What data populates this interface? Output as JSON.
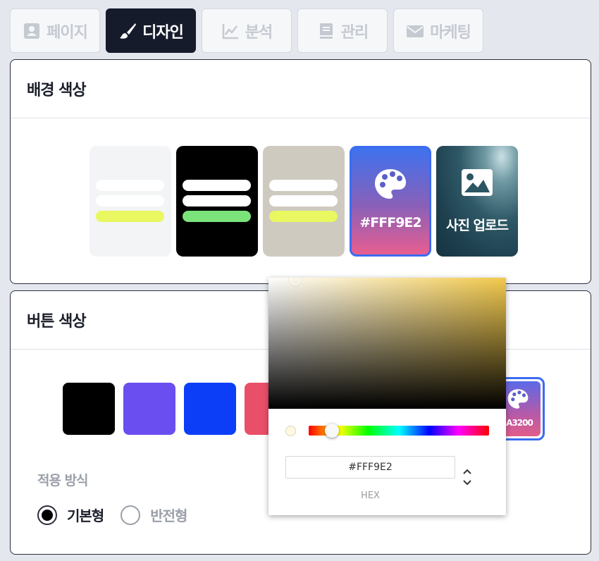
{
  "tabs": [
    {
      "label": "페이지",
      "icon": "id-card-icon",
      "active": false
    },
    {
      "label": "디자인",
      "icon": "paintbrush-icon",
      "active": true
    },
    {
      "label": "분석",
      "icon": "line-chart-icon",
      "active": false
    },
    {
      "label": "관리",
      "icon": "book-icon",
      "active": false
    },
    {
      "label": "마케팅",
      "icon": "envelope-icon",
      "active": false
    }
  ],
  "background_section": {
    "title": "배경 색상",
    "options": [
      {
        "name": "light",
        "bg": "#f3f4f6",
        "bars": [
          "#ffffff",
          "#ffffff",
          "#e9f760"
        ]
      },
      {
        "name": "dark",
        "bg": "#000000",
        "bars": [
          "#ffffff",
          "#ffffff",
          "#7ae47a"
        ]
      },
      {
        "name": "beige",
        "bg": "#cfcac0",
        "bars": [
          "#ffffff",
          "#ffffff",
          "#e9f760"
        ]
      }
    ],
    "custom_color_label": "#FFF9E2",
    "upload_label": "사진 업로드"
  },
  "button_section": {
    "title": "버튼 색상",
    "swatches": [
      "#000000",
      "#6b4ef0",
      "#0d3ef7",
      "#ea4f6a"
    ],
    "custom_color_label": "A3200",
    "apply_label": "적용 방식",
    "radio_options": [
      {
        "label": "기본형",
        "selected": true
      },
      {
        "label": "반전형",
        "selected": false
      }
    ]
  },
  "color_picker": {
    "hue_color": "#f2c94c",
    "hex_value": "#FFF9E2",
    "hex_label": "HEX",
    "hue_position": 0.13
  }
}
